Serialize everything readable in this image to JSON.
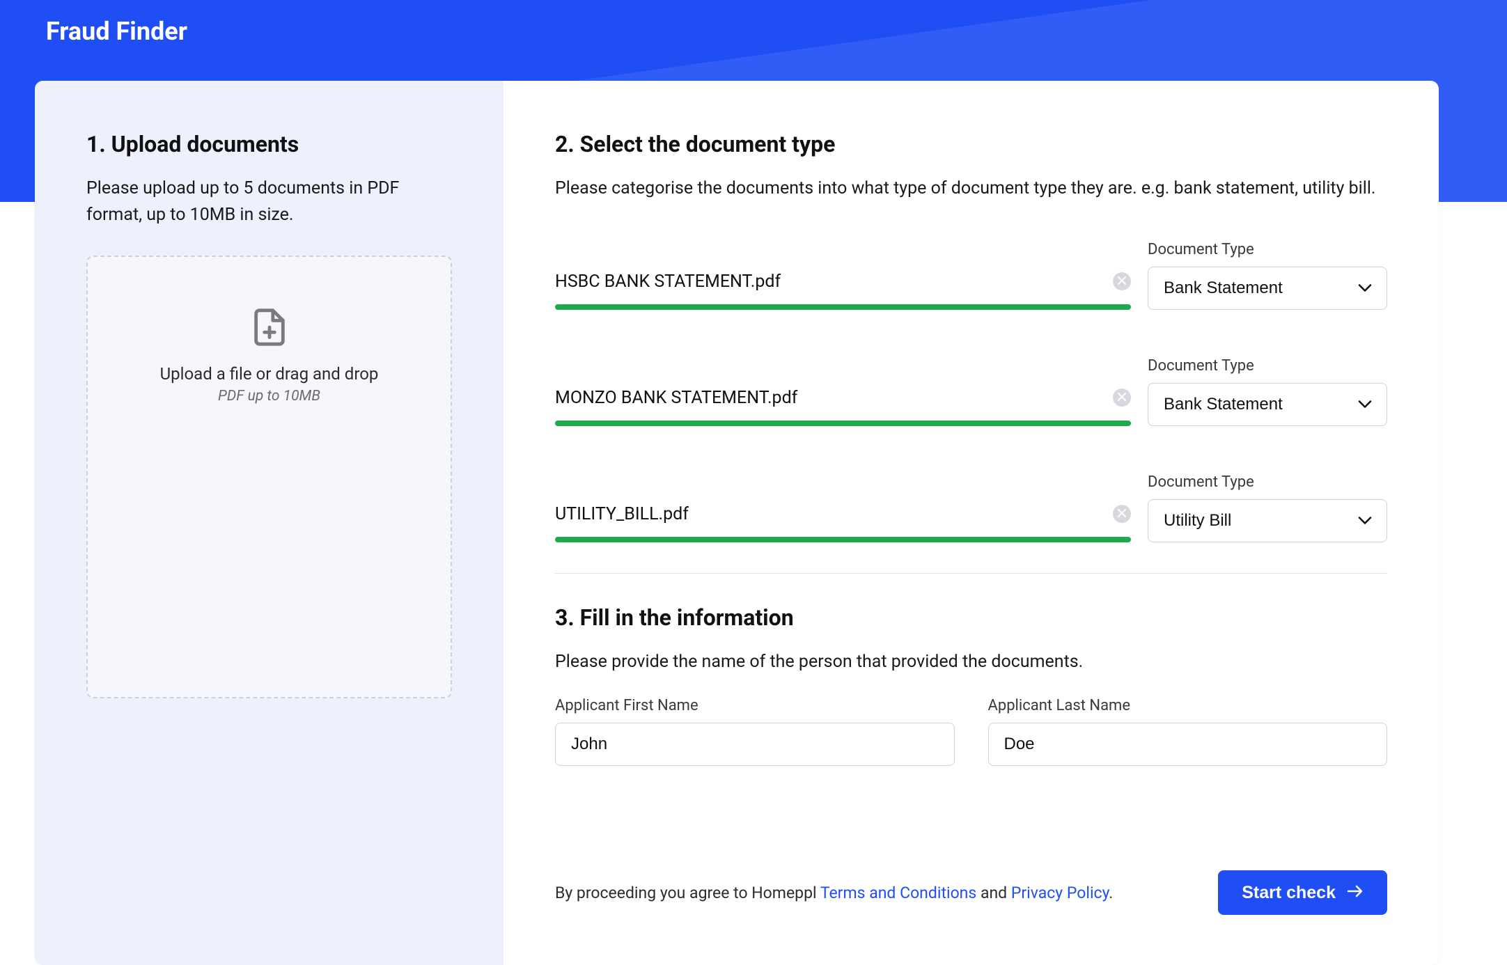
{
  "appTitle": "Fraud Finder",
  "step1": {
    "title": "1. Upload documents",
    "desc": "Please upload up to 5 documents in PDF format, up to 10MB in size.",
    "upload": {
      "primary": "Upload a file or drag and drop",
      "secondary": "PDF up to 10MB"
    }
  },
  "step2": {
    "title": "2. Select the document type",
    "desc": "Please categorise the documents into what type of document type they are. e.g. bank statement, utility bill.",
    "docTypeLabel": "Document Type",
    "documents": [
      {
        "filename": "HSBC BANK STATEMENT.pdf",
        "selectedType": "Bank Statement"
      },
      {
        "filename": "MONZO BANK STATEMENT.pdf",
        "selectedType": "Bank Statement"
      },
      {
        "filename": "UTILITY_BILL.pdf",
        "selectedType": "Utility Bill"
      }
    ]
  },
  "step3": {
    "title": "3. Fill in the information",
    "desc": "Please provide the name of the person that provided the documents.",
    "firstNameLabel": "Applicant First Name",
    "lastNameLabel": "Applicant Last Name",
    "firstNameValue": "John",
    "lastNameValue": "Doe"
  },
  "footer": {
    "prefix": "By proceeding you agree to Homeppl ",
    "termsLabel": "Terms and Conditions",
    "joiner": " and ",
    "privacyLabel": "Privacy Policy",
    "suffix": ".",
    "startLabel": "Start check"
  },
  "colors": {
    "primary": "#1f4ef5",
    "progress": "#1fa94a"
  }
}
